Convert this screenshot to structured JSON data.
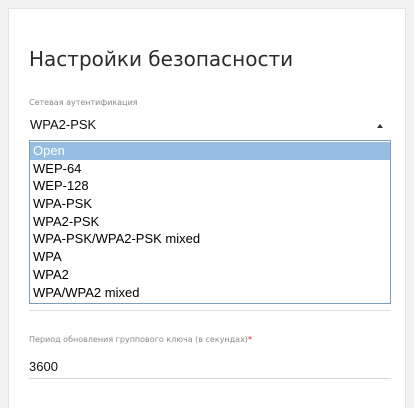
{
  "section": {
    "title": "Настройки безопасности"
  },
  "auth": {
    "label": "Сетевая аутентификация",
    "selected_value": "WPA2-PSK",
    "options": [
      "Open",
      "WEP-64",
      "WEP-128",
      "WPA-PSK",
      "WPA2-PSK",
      "WPA-PSK/WPA2-PSK mixed",
      "WPA",
      "WPA2",
      "WPA/WPA2 mixed"
    ],
    "highlighted_option": "Open"
  },
  "group_key_period": {
    "label": "Период обновления группового ключа (в секундах)",
    "required_mark": "*",
    "value": "3600"
  },
  "colors": {
    "highlight": "#97bee0",
    "dropdown_border": "#7e9bb8",
    "required": "#d9232d"
  },
  "icons": {
    "select_arrow": "chevron-up-icon"
  }
}
